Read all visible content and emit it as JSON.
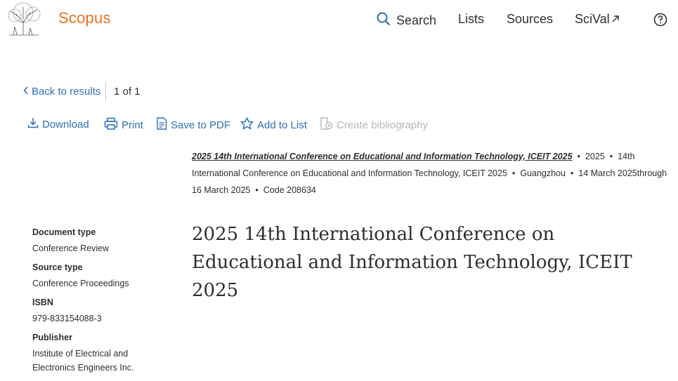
{
  "header": {
    "brand": "Scopus",
    "nav": {
      "search": "Search",
      "lists": "Lists",
      "sources": "Sources",
      "scival": "SciVal"
    },
    "icons": [
      "elsevier-tree-logo",
      "search-icon",
      "external-arrow-icon",
      "help-icon"
    ]
  },
  "results_nav": {
    "back": "Back to results",
    "pager": "1 of 1"
  },
  "toolbar": {
    "download": "Download",
    "print": "Print",
    "save_pdf": "Save to PDF",
    "add_list": "Add to List",
    "bibliography": "Create bibliography"
  },
  "source": {
    "title": "2025 14th International Conference on Educational and Information Technology, ICEIT 2025",
    "year": "2025",
    "conference": "14th International Conference on Educational and Information Technology, ICEIT 2025",
    "location": "Guangzhou",
    "dates": "14 March 2025through 16 March 2025",
    "code": "Code 208634"
  },
  "details": {
    "document_type_label": "Document type",
    "document_type": "Conference Review",
    "source_type_label": "Source type",
    "source_type": "Conference Proceedings",
    "isbn_label": "ISBN",
    "isbn": "979-833154088-3",
    "publisher_label": "Publisher",
    "publisher": "Institute of Electrical and Electronics Engineers Inc."
  },
  "document": {
    "title": "2025 14th International Conference on Educational and Information Technology, ICEIT 2025"
  },
  "colors": {
    "brand": "#e9711c",
    "link": "#2e6eb5",
    "disabled": "#b7b7b7",
    "text": "#2e2e2e"
  }
}
